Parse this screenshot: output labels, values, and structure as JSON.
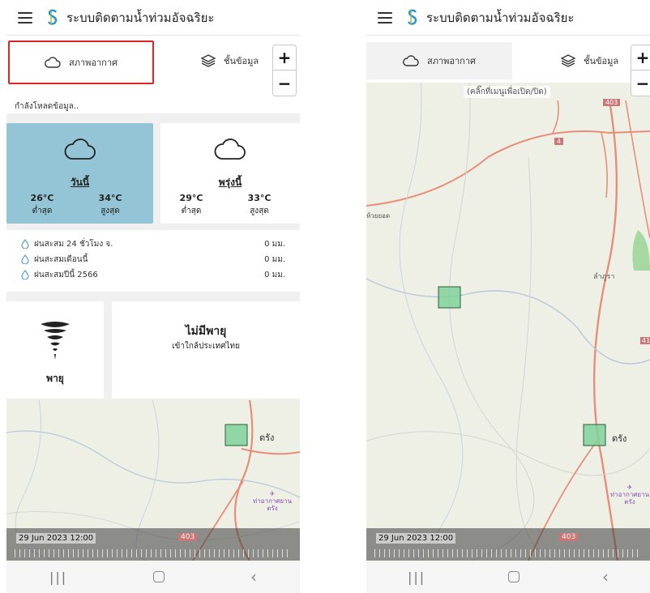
{
  "app": {
    "title": "ระบบติดตามน้ำท่วมอัจฉริยะ"
  },
  "tabs": {
    "weather": "สภาพอากาศ",
    "layers": "ชั้นข้อมูล"
  },
  "zoom": {
    "in": "+",
    "out": "−"
  },
  "status": {
    "loading": "กำลังโหลดข้อมูล.."
  },
  "forecast": {
    "today": {
      "label": "วันนี้",
      "min": "26°C",
      "min_label": "ต่ำสุด",
      "max": "34°C",
      "max_label": "สูงสุด"
    },
    "tomorrow": {
      "label": "พรุ่งนี้",
      "min": "29°C",
      "min_label": "ต่ำสุด",
      "max": "33°C",
      "max_label": "สูงสุด"
    }
  },
  "rainfall": [
    {
      "label": "ฝนสะสม 24 ชั่วโมง จ.",
      "value": "0 มม."
    },
    {
      "label": "ฝนสะสมเดือนนี้",
      "value": "0 มม."
    },
    {
      "label": "ฝนสะสมปีนี้ 2566",
      "value": "0 มม."
    }
  ],
  "storm": {
    "icon_label": "พายุ",
    "title": "ไม่มีพายุ",
    "subtitle": "เข้าใกล้ประเทศไทย"
  },
  "map": {
    "city": "ตรัง",
    "airport": "ท่าอากาศยาน ตรัง",
    "road_403": "403",
    "road_4": "4",
    "road_41": "41",
    "town_lamphura": "ลำภูรา",
    "town_west": "ห้วยยอด",
    "hint": "(คลิ๊กที่เมนูเพื่อเปิด/ปิด)"
  },
  "timeline": {
    "timestamp": "29 Jun 2023 12:00"
  },
  "colors": {
    "accent_today": "#93c5d6",
    "highlight": "#d9262b",
    "grid_cell": "#7fd19a"
  }
}
